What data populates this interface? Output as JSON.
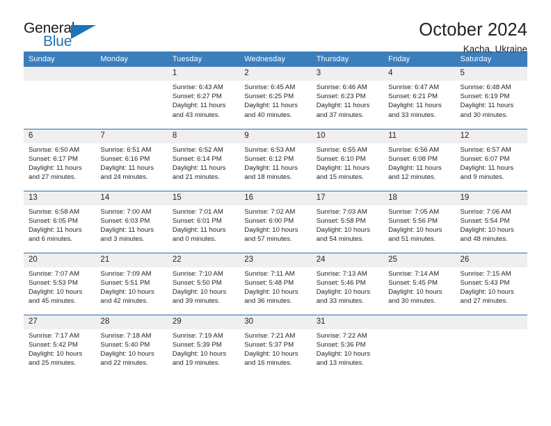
{
  "brand": {
    "name_top": "General",
    "name_bottom": "Blue",
    "accent_color": "#1b75bb"
  },
  "header": {
    "title": "October 2024",
    "location": "Kacha, Ukraine"
  },
  "calendar": {
    "header_bg": "#3b7ebc",
    "row_divider_color": "#2a6dab",
    "daynum_bg": "#efefef",
    "weekday_labels": [
      "Sunday",
      "Monday",
      "Tuesday",
      "Wednesday",
      "Thursday",
      "Friday",
      "Saturday"
    ],
    "weeks": [
      [
        {
          "day": "",
          "lines": []
        },
        {
          "day": "",
          "lines": []
        },
        {
          "day": "1",
          "lines": [
            "Sunrise: 6:43 AM",
            "Sunset: 6:27 PM",
            "Daylight: 11 hours",
            "and 43 minutes."
          ]
        },
        {
          "day": "2",
          "lines": [
            "Sunrise: 6:45 AM",
            "Sunset: 6:25 PM",
            "Daylight: 11 hours",
            "and 40 minutes."
          ]
        },
        {
          "day": "3",
          "lines": [
            "Sunrise: 6:46 AM",
            "Sunset: 6:23 PM",
            "Daylight: 11 hours",
            "and 37 minutes."
          ]
        },
        {
          "day": "4",
          "lines": [
            "Sunrise: 6:47 AM",
            "Sunset: 6:21 PM",
            "Daylight: 11 hours",
            "and 33 minutes."
          ]
        },
        {
          "day": "5",
          "lines": [
            "Sunrise: 6:48 AM",
            "Sunset: 6:19 PM",
            "Daylight: 11 hours",
            "and 30 minutes."
          ]
        }
      ],
      [
        {
          "day": "6",
          "lines": [
            "Sunrise: 6:50 AM",
            "Sunset: 6:17 PM",
            "Daylight: 11 hours",
            "and 27 minutes."
          ]
        },
        {
          "day": "7",
          "lines": [
            "Sunrise: 6:51 AM",
            "Sunset: 6:16 PM",
            "Daylight: 11 hours",
            "and 24 minutes."
          ]
        },
        {
          "day": "8",
          "lines": [
            "Sunrise: 6:52 AM",
            "Sunset: 6:14 PM",
            "Daylight: 11 hours",
            "and 21 minutes."
          ]
        },
        {
          "day": "9",
          "lines": [
            "Sunrise: 6:53 AM",
            "Sunset: 6:12 PM",
            "Daylight: 11 hours",
            "and 18 minutes."
          ]
        },
        {
          "day": "10",
          "lines": [
            "Sunrise: 6:55 AM",
            "Sunset: 6:10 PM",
            "Daylight: 11 hours",
            "and 15 minutes."
          ]
        },
        {
          "day": "11",
          "lines": [
            "Sunrise: 6:56 AM",
            "Sunset: 6:08 PM",
            "Daylight: 11 hours",
            "and 12 minutes."
          ]
        },
        {
          "day": "12",
          "lines": [
            "Sunrise: 6:57 AM",
            "Sunset: 6:07 PM",
            "Daylight: 11 hours",
            "and 9 minutes."
          ]
        }
      ],
      [
        {
          "day": "13",
          "lines": [
            "Sunrise: 6:58 AM",
            "Sunset: 6:05 PM",
            "Daylight: 11 hours",
            "and 6 minutes."
          ]
        },
        {
          "day": "14",
          "lines": [
            "Sunrise: 7:00 AM",
            "Sunset: 6:03 PM",
            "Daylight: 11 hours",
            "and 3 minutes."
          ]
        },
        {
          "day": "15",
          "lines": [
            "Sunrise: 7:01 AM",
            "Sunset: 6:01 PM",
            "Daylight: 11 hours",
            "and 0 minutes."
          ]
        },
        {
          "day": "16",
          "lines": [
            "Sunrise: 7:02 AM",
            "Sunset: 6:00 PM",
            "Daylight: 10 hours",
            "and 57 minutes."
          ]
        },
        {
          "day": "17",
          "lines": [
            "Sunrise: 7:03 AM",
            "Sunset: 5:58 PM",
            "Daylight: 10 hours",
            "and 54 minutes."
          ]
        },
        {
          "day": "18",
          "lines": [
            "Sunrise: 7:05 AM",
            "Sunset: 5:56 PM",
            "Daylight: 10 hours",
            "and 51 minutes."
          ]
        },
        {
          "day": "19",
          "lines": [
            "Sunrise: 7:06 AM",
            "Sunset: 5:54 PM",
            "Daylight: 10 hours",
            "and 48 minutes."
          ]
        }
      ],
      [
        {
          "day": "20",
          "lines": [
            "Sunrise: 7:07 AM",
            "Sunset: 5:53 PM",
            "Daylight: 10 hours",
            "and 45 minutes."
          ]
        },
        {
          "day": "21",
          "lines": [
            "Sunrise: 7:09 AM",
            "Sunset: 5:51 PM",
            "Daylight: 10 hours",
            "and 42 minutes."
          ]
        },
        {
          "day": "22",
          "lines": [
            "Sunrise: 7:10 AM",
            "Sunset: 5:50 PM",
            "Daylight: 10 hours",
            "and 39 minutes."
          ]
        },
        {
          "day": "23",
          "lines": [
            "Sunrise: 7:11 AM",
            "Sunset: 5:48 PM",
            "Daylight: 10 hours",
            "and 36 minutes."
          ]
        },
        {
          "day": "24",
          "lines": [
            "Sunrise: 7:13 AM",
            "Sunset: 5:46 PM",
            "Daylight: 10 hours",
            "and 33 minutes."
          ]
        },
        {
          "day": "25",
          "lines": [
            "Sunrise: 7:14 AM",
            "Sunset: 5:45 PM",
            "Daylight: 10 hours",
            "and 30 minutes."
          ]
        },
        {
          "day": "26",
          "lines": [
            "Sunrise: 7:15 AM",
            "Sunset: 5:43 PM",
            "Daylight: 10 hours",
            "and 27 minutes."
          ]
        }
      ],
      [
        {
          "day": "27",
          "lines": [
            "Sunrise: 7:17 AM",
            "Sunset: 5:42 PM",
            "Daylight: 10 hours",
            "and 25 minutes."
          ]
        },
        {
          "day": "28",
          "lines": [
            "Sunrise: 7:18 AM",
            "Sunset: 5:40 PM",
            "Daylight: 10 hours",
            "and 22 minutes."
          ]
        },
        {
          "day": "29",
          "lines": [
            "Sunrise: 7:19 AM",
            "Sunset: 5:39 PM",
            "Daylight: 10 hours",
            "and 19 minutes."
          ]
        },
        {
          "day": "30",
          "lines": [
            "Sunrise: 7:21 AM",
            "Sunset: 5:37 PM",
            "Daylight: 10 hours",
            "and 16 minutes."
          ]
        },
        {
          "day": "31",
          "lines": [
            "Sunrise: 7:22 AM",
            "Sunset: 5:36 PM",
            "Daylight: 10 hours",
            "and 13 minutes."
          ]
        },
        {
          "day": "",
          "lines": []
        },
        {
          "day": "",
          "lines": []
        }
      ]
    ]
  }
}
